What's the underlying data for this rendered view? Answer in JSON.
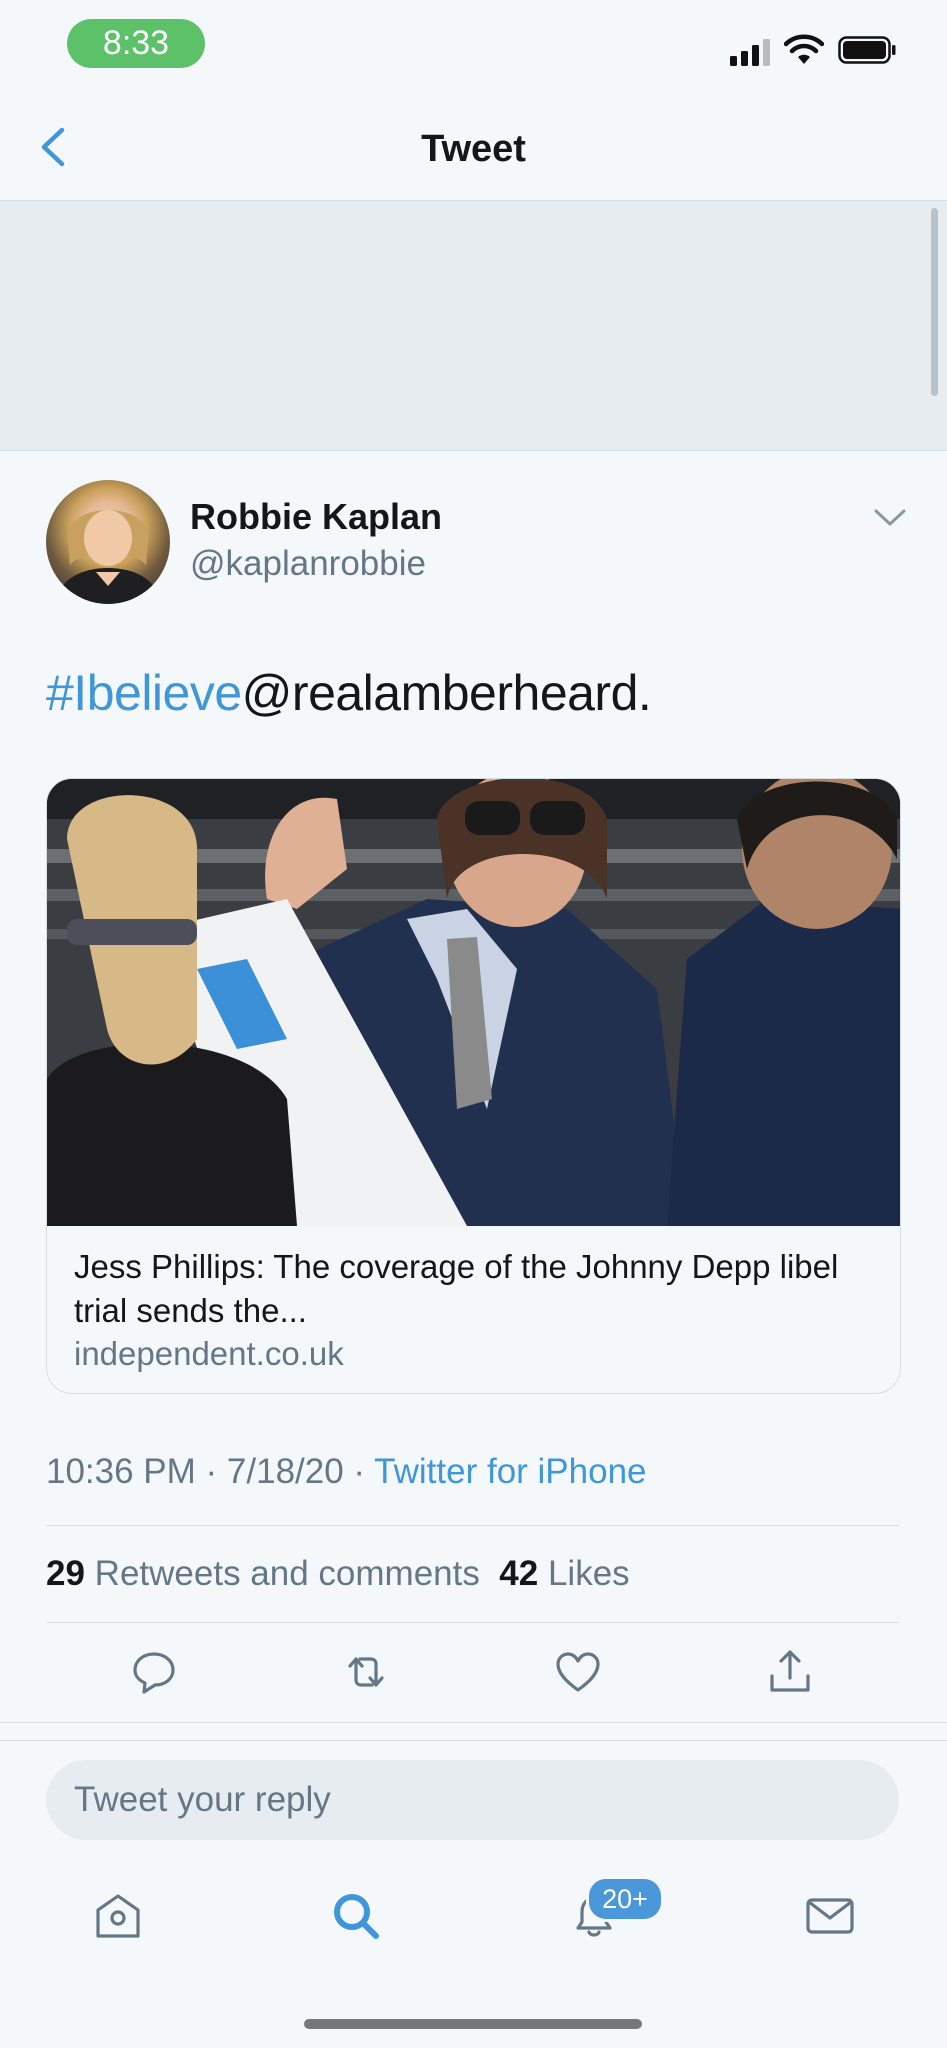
{
  "status_bar": {
    "time": "8:33"
  },
  "nav": {
    "title": "Tweet"
  },
  "tweet": {
    "author_name": "Robbie Kaplan",
    "author_handle": "@kaplanrobbie",
    "text_hashtag": "#Ibelieve",
    "text_rest": "@realamberheard.",
    "card": {
      "title": "Jess Phillips: The coverage of the Johnny Depp libel trial sends the...",
      "domain": "independent.co.uk"
    },
    "timestamp": "10:36 PM · 7/18/20 · ",
    "source": "Twitter for iPhone",
    "retweets_count": "29",
    "retweets_label": "Retweets and comments",
    "likes_count": "42",
    "likes_label": "Likes"
  },
  "reply": {
    "placeholder": "Tweet your reply"
  },
  "tab_bar": {
    "notifications_badge": "20+"
  },
  "colors": {
    "accent": "#3f96d9",
    "secondary_text": "#657786",
    "status_pill": "#5cc168"
  }
}
